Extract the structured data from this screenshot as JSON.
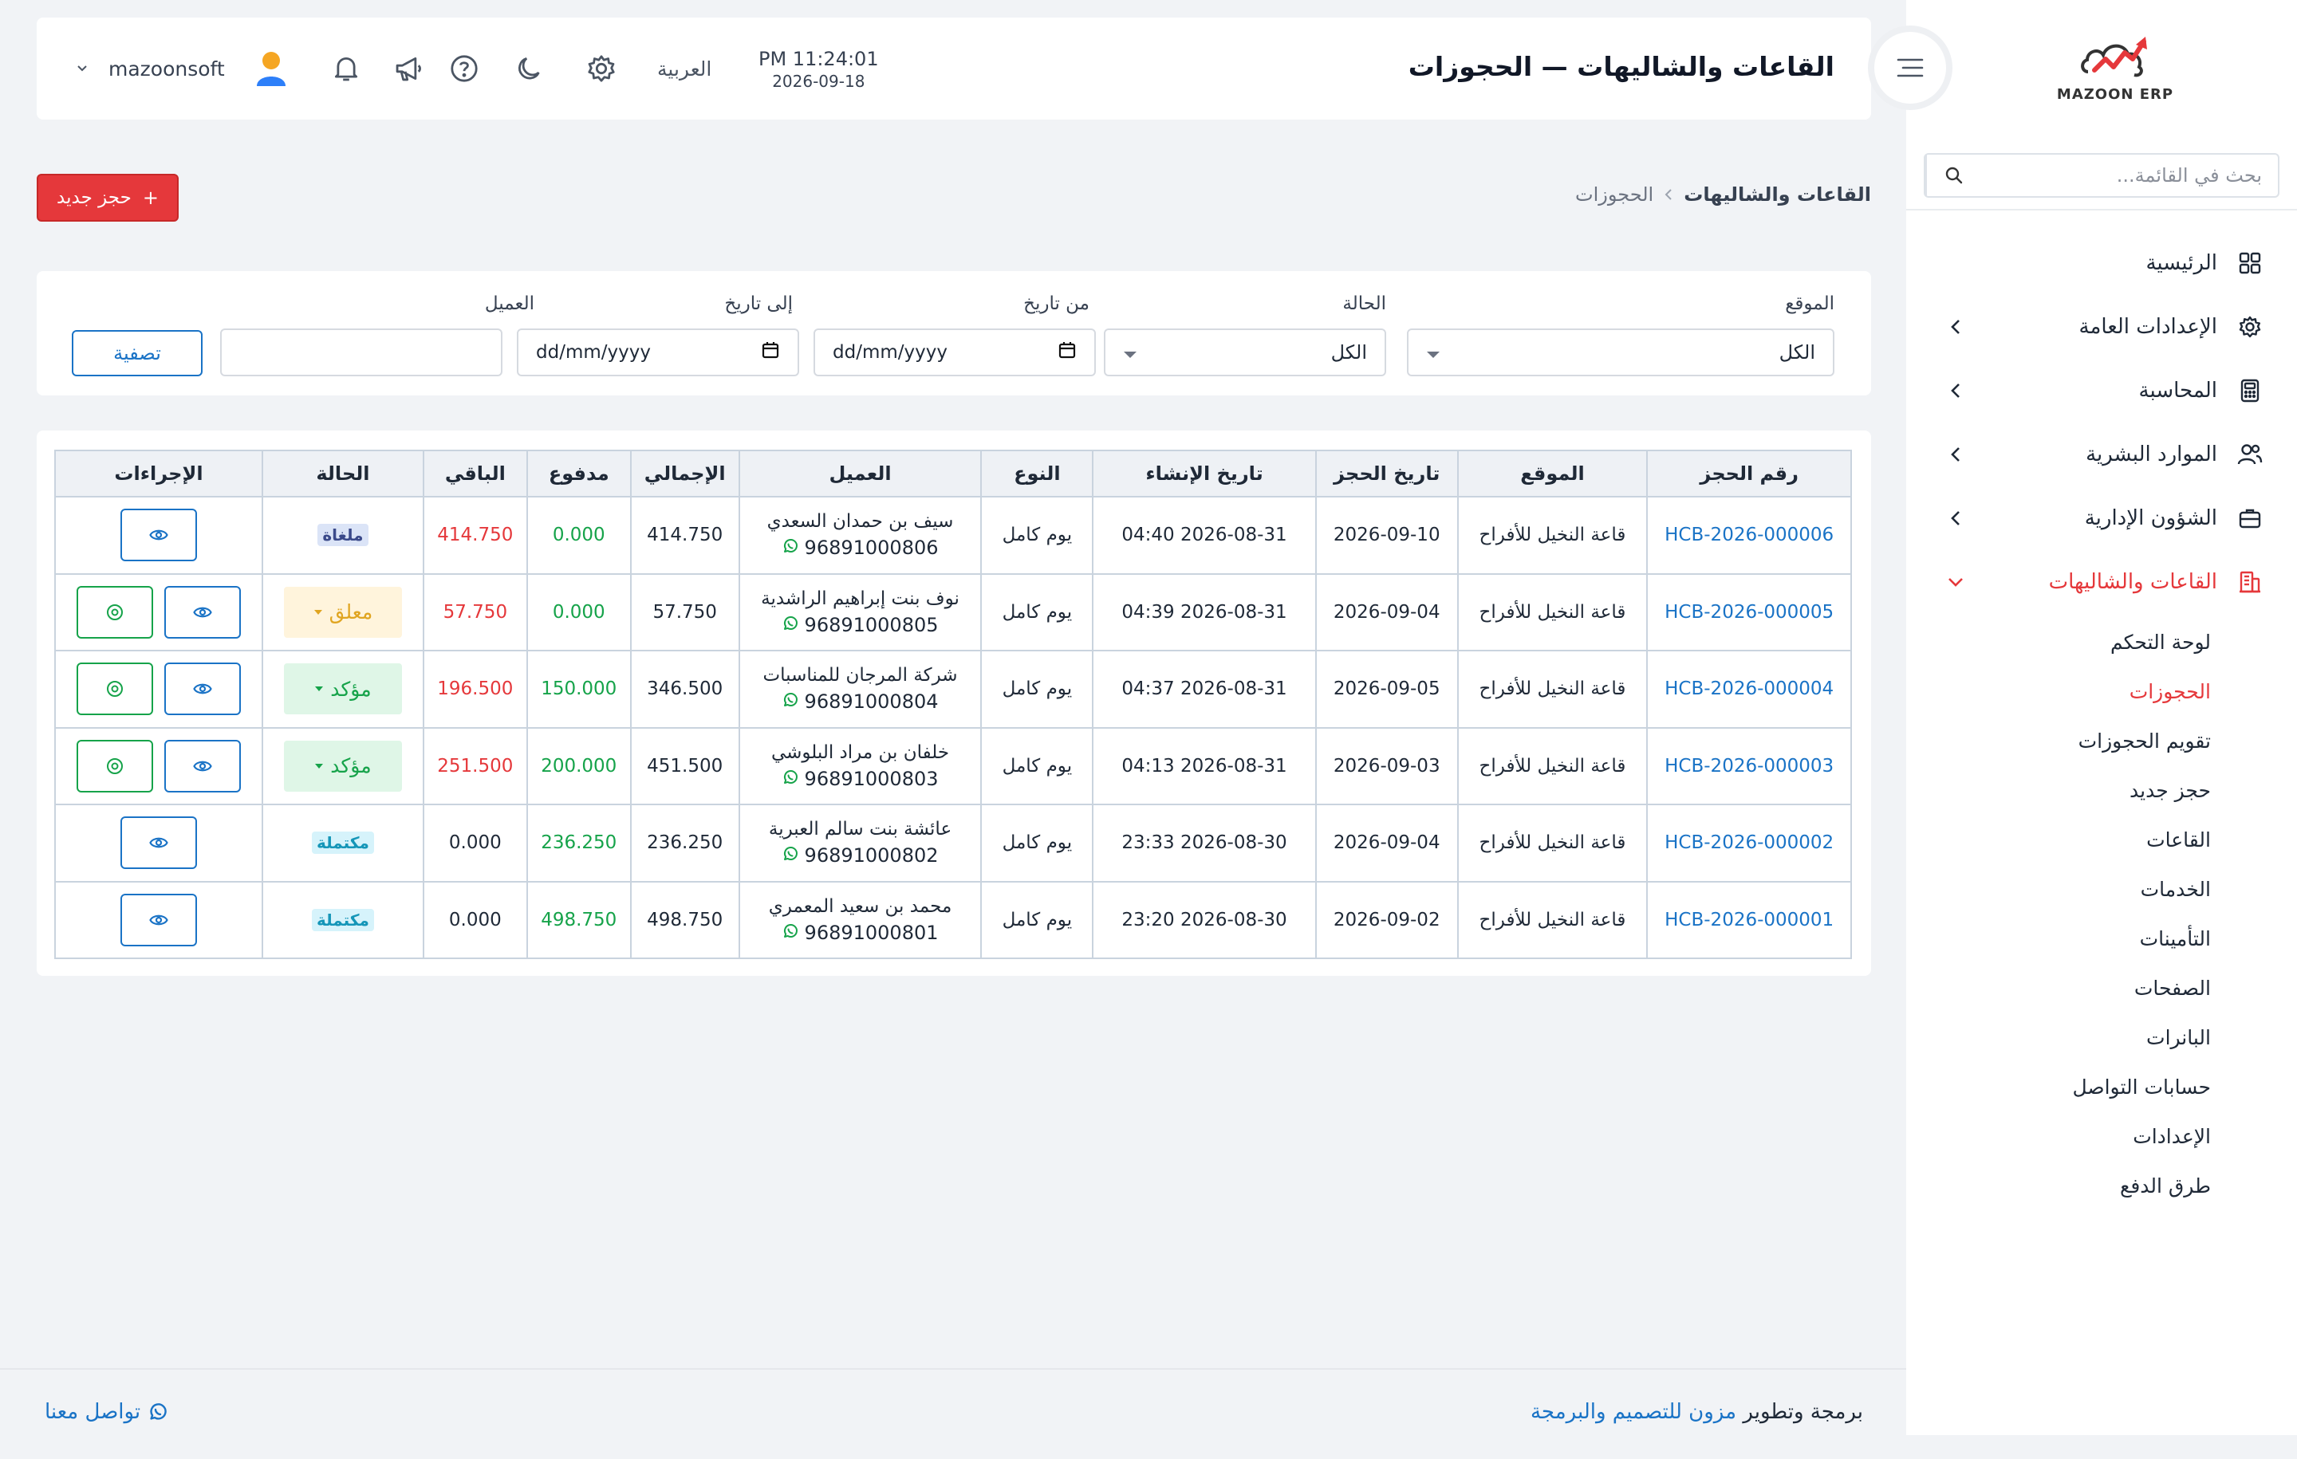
{
  "brand": {
    "logo_text": "MAZOON ERP",
    "accent": "#e5383b",
    "link": "#1a73c6"
  },
  "sidebar": {
    "search_placeholder": "بحث في القائمة...",
    "items": [
      {
        "label": "الرئيسية",
        "icon": "grid-icon"
      },
      {
        "label": "الإعدادات العامة",
        "icon": "gear-icon"
      },
      {
        "label": "المحاسبة",
        "icon": "calculator-icon"
      },
      {
        "label": "الموارد البشرية",
        "icon": "users-icon"
      },
      {
        "label": "الشؤون الإدارية",
        "icon": "briefcase-icon"
      },
      {
        "label": "القاعات والشاليهات",
        "icon": "building-icon"
      }
    ],
    "sub_items": [
      {
        "label": "لوحة التحكم"
      },
      {
        "label": "الحجوزات"
      },
      {
        "label": "تقويم الحجوزات"
      },
      {
        "label": "حجز جديد"
      },
      {
        "label": "القاعات"
      },
      {
        "label": "الخدمات"
      },
      {
        "label": "التأمينات"
      },
      {
        "label": "الصفحات"
      },
      {
        "label": "البانرات"
      },
      {
        "label": "حسابات التواصل"
      },
      {
        "label": "الإعدادات"
      },
      {
        "label": "طرق الدفع"
      }
    ]
  },
  "header": {
    "title": "القاعات والشاليهات — الحجوزات",
    "time": "PM 11:24:01",
    "date": "2026-09-18",
    "language": "العربية",
    "username": "mazoonsoft"
  },
  "breadcrumb": {
    "parent": "القاعات والشاليهات",
    "current": "الحجوزات"
  },
  "actions": {
    "new_booking": "حجز جديد"
  },
  "filters": {
    "location_label": "الموقع",
    "location_value": "الكل",
    "status_label": "الحالة",
    "status_value": "الكل",
    "from_label": "من تاريخ",
    "from_placeholder": "dd/mm/yyyy",
    "to_label": "إلى تاريخ",
    "to_placeholder": "dd/mm/yyyy",
    "customer_label": "العميل",
    "customer_value": "",
    "filter_button": "تصفية"
  },
  "table": {
    "headers": [
      "رقم الحجز",
      "الموقع",
      "تاريخ الحجز",
      "تاريخ الإنشاء",
      "النوع",
      "العميل",
      "الإجمالي",
      "مدفوع",
      "الباقي",
      "الحالة",
      "الإجراءات"
    ],
    "rows": [
      {
        "ref": "HCB-2026-000006",
        "location": "قاعة النخيل للأفراح",
        "booking_date": "2026-09-10",
        "created": "2026-08-31 04:40",
        "type": "يوم كامل",
        "customer": "سيف بن حمدان السعدي",
        "phone": "96891000806",
        "total": "414.750",
        "paid": "0.000",
        "remaining": "414.750",
        "status": "ملغاة"
      },
      {
        "ref": "HCB-2026-000005",
        "location": "قاعة النخيل للأفراح",
        "booking_date": "2026-09-04",
        "created": "2026-08-31 04:39",
        "type": "يوم كامل",
        "customer": "نوف بنت إبراهيم الراشدية",
        "phone": "96891000805",
        "total": "57.750",
        "paid": "0.000",
        "remaining": "57.750",
        "status": "معلق"
      },
      {
        "ref": "HCB-2026-000004",
        "location": "قاعة النخيل للأفراح",
        "booking_date": "2026-09-05",
        "created": "2026-08-31 04:37",
        "type": "يوم كامل",
        "customer": "شركة المرجان للمناسبات",
        "phone": "96891000804",
        "total": "346.500",
        "paid": "150.000",
        "remaining": "196.500",
        "status": "مؤكد"
      },
      {
        "ref": "HCB-2026-000003",
        "location": "قاعة النخيل للأفراح",
        "booking_date": "2026-09-03",
        "created": "2026-08-31 04:13",
        "type": "يوم كامل",
        "customer": "خلفان بن مراد البلوشي",
        "phone": "96891000803",
        "total": "451.500",
        "paid": "200.000",
        "remaining": "251.500",
        "status": "مؤكد"
      },
      {
        "ref": "HCB-2026-000002",
        "location": "قاعة النخيل للأفراح",
        "booking_date": "2026-09-04",
        "created": "2026-08-30 23:33",
        "type": "يوم كامل",
        "customer": "عائشة بنت سالم العبرية",
        "phone": "96891000802",
        "total": "236.250",
        "paid": "236.250",
        "remaining": "0.000",
        "status": "مكتملة"
      },
      {
        "ref": "HCB-2026-000001",
        "location": "قاعة النخيل للأفراح",
        "booking_date": "2026-09-02",
        "created": "2026-08-30 23:20",
        "type": "يوم كامل",
        "customer": "محمد بن سعيد المعمري",
        "phone": "96891000801",
        "total": "498.750",
        "paid": "498.750",
        "remaining": "0.000",
        "status": "مكتملة"
      }
    ]
  },
  "footer": {
    "credit_prefix": "برمجة وتطوير",
    "credit_brand": "مزون للتصميم والبرمجة",
    "contact": "تواصل معنا"
  }
}
